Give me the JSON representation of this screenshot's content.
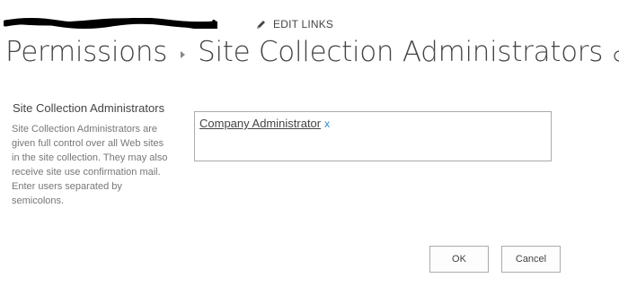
{
  "top_nav": {
    "edit_links_label": "EDIT LINKS"
  },
  "breadcrumb": {
    "parent": "Permissions",
    "current": "Site Collection Administrators"
  },
  "section": {
    "heading": "Site Collection Administrators",
    "description": "Site Collection Administrators are given full control over all Web sites in the site collection. They may also receive site use confirmation mail. Enter users separated by semicolons."
  },
  "people_picker": {
    "entries": [
      {
        "name": "Company Administrator",
        "remove_label": "x"
      }
    ]
  },
  "buttons": {
    "ok_label": "OK",
    "cancel_label": "Cancel"
  },
  "colors": {
    "text": "#444444",
    "muted_text": "#777777",
    "link_accent": "#2a8dd4",
    "border": "#ababab"
  },
  "icons": {
    "edit": "pencil-icon",
    "info": "info-icon",
    "separator": "breadcrumb-arrow-icon"
  }
}
